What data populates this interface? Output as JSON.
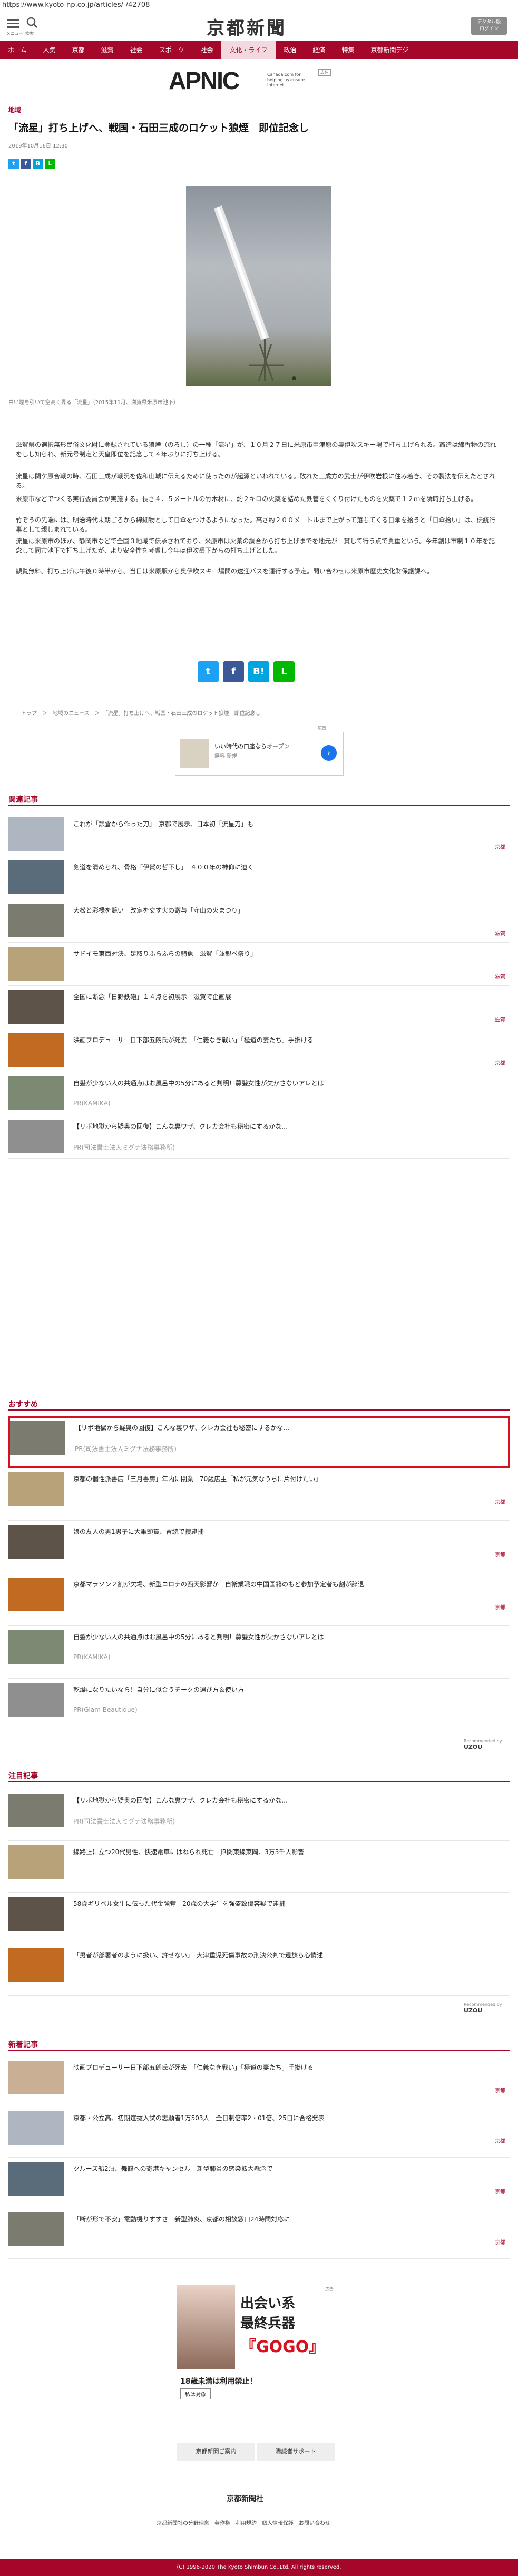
{
  "url": "https://www.kyoto-np.co.jp/articles/-/42708",
  "header": {
    "menu_label": "メニュー",
    "search_label": "検索",
    "logo": "京都新聞",
    "digital_button": "デジタル版\nログイン"
  },
  "nav": [
    "ホーム",
    "人気",
    "京都",
    "滋賀",
    "社会",
    "スポーツ",
    "社会",
    "文化・ライフ",
    "政治",
    "経済",
    "特集",
    "京都新聞デジ"
  ],
  "nav_active": 7,
  "ap": {
    "logo": "APNIC",
    "tagline": "Canada.com for helping us ensure Internet",
    "badge": "広告"
  },
  "article": {
    "category": "地域",
    "title": "「流星」打ち上げへ、戦国・石田三成のロケット狼煙　即位記念し",
    "date": "2019年10月16日 12:30",
    "caption": "白い煙を引いて空高く昇る「流星」（2015年11月、滋賀県米原市池下）",
    "paragraphs": [
      "滋賀県の選択無形民俗文化財に登録されている狼煙（のろし）の一種「流星」が、１０月２７日に米原市甲津原の奥伊吹スキー場で打ち上げられる。竈造は線香物の流れをしし知られ、新元号制定と天皇即位を記念して４年ぶりに打ち上げる。",
      "流星は関ケ原合戦の時、石田三成が戦況を佐和山城に伝えるために使ったのが起源といわれている。敗れた三成方の武士が伊吹岩根に住み着き、その製法を伝えたとされる。",
      "米原市などでつくる実行委員会が実施する。長さ４．５メートルの竹木材に、約２キロの火薬を詰めた鉄管をくくり付けたものを火薬で１２ｍを瞬時打ち上げる。",
      "竹ぞうの先端には、明治時代末期ごろから綿細物として日傘をつけるようになった。高さ約２００メートルまで上がって落ちてくる日傘を拾うと「日傘拾い」は、伝統行事として親しまれている。",
      "流星は米原市のほか、静岡市などで全国３地域で伝承されており、米原市は火薬の調合から打ち上げまでを地元が一貫して行う点で貴重という。今年創は市制１０年を記念して同市池下で打ち上げたが、より安全性を考慮し今年は伊吹岳下からの打ち上げとした。",
      "観覧無料。打ち上げは午後０時半から。当日は米原駅から奥伊吹スキー場間の送迎バスを運行する予定。問い合わせは米原市歴史文化財保護課へ。"
    ],
    "breadcrumb": "トップ　＞　地域のニュース　＞　「流星」打ち上げへ、戦国・石田三成のロケット狼煙　即位記念し"
  },
  "ad_small": {
    "label": "広告",
    "line1": "いい時代の口座ならオープン",
    "line2": "無料 新規"
  },
  "related": {
    "title": "関連記事",
    "items": [
      {
        "text": "これが「鎌倉から作った刀」　京都で展示、日本初「流星刀」も",
        "tag": "京都"
      },
      {
        "text": "剣道を清められ、骨格「伊賀の哲下し」　４００年の神仰に迫く",
        "tag": ""
      },
      {
        "text": "大松と彩禄を競い　改定を交す火の寄与「守山の火まつり」",
        "tag": "滋賀"
      },
      {
        "text": "サドイモ東西対決、足取りふらふらの騎魚　滋賀「並観べ祭り」",
        "tag": "滋賀"
      },
      {
        "text": "全国に断念「日野鉄砲」１４点を初展示　滋賀で企画展",
        "tag": "滋賀"
      },
      {
        "text": "映画プロデューサー日下部五朗氏が死去　「仁義なき戦い」「極道の妻たち」手掛ける",
        "tag": "京都"
      },
      {
        "text": "自髪が少ない人の共通点はお風呂中の5分にあると判明！募髪女性が欠かさないアレとは",
        "pr": "PR(KAMIKA)"
      },
      {
        "text": "【リボ地獄から疑奥の回復】こんな裏ワザ、クレカ会社も秘密にするかな…",
        "pr": "PR(司法書士法人ミグナ法務事務所)"
      }
    ]
  },
  "recommend": {
    "title": "おすすめ",
    "items": [
      {
        "text": "【リボ地獄から疑奥の回復】こんな裏ワザ、クレカ会社も秘密にするかな…",
        "pr": "PR(司法書士法人ミグナ法務事務所)",
        "tag": ""
      },
      {
        "text": "京都の個性派書店「三月書房」年内に閉業　70歳店主「私が元気なうちに片付けたい」",
        "tag": "京都"
      },
      {
        "text": "娘の友人の男1男子に大乗頭賞、冒続で捜逮捕",
        "tag": "京都"
      },
      {
        "text": "京都マラソン２割が欠場、新型コロナの西天影響か　自衛業職の中国国籍のもど参加予定者も割が辞退",
        "tag": "京都"
      },
      {
        "text": "自髪が少ない人の共通点はお風呂中の5分にあると判明！募髪女性が欠かさないアレとは",
        "pr": "PR(KAMIKA)"
      },
      {
        "text": "乾燥になりたいなら！自分に似合うチークの選び方＆使い方",
        "pr": "PR(Glam Beautique)"
      }
    ],
    "powered": "Recommended by",
    "powered_brand": "UZOU"
  },
  "attention": {
    "title": "注目記事",
    "items": [
      {
        "text": "【リボ地獄から疑奥の回復】こんな裏ワザ、クレカ会社も秘密にするかな…",
        "pr": "PR(司法書士法人ミグナ法務事務所)"
      },
      {
        "text": "線路上に立つ20代男性、快速電車にはねられ死亡　JR関東線東岡、3万3千人影響",
        "tag": ""
      },
      {
        "text": "58歳ギリベル女生に伝った代金強奪　20歳の大学生を強盗致傷容疑で逮捕",
        "tag": ""
      },
      {
        "text": "「男者が部署者のように扱い、許せない」　大津重児死傷事故の刑決公判で遺族ら心情述",
        "tag": ""
      }
    ],
    "powered": "Recommended by",
    "powered_brand": "UZOU"
  },
  "latest": {
    "title": "新着記事",
    "items": [
      {
        "text": "映画プロデューサー日下部五朗氏が死去　「仁義なき戦い」「極道の妻たち」手掛ける",
        "tag": "京都"
      },
      {
        "text": "京都・公立高、初期選抜入試の志願者1万503人　全日制倍率2・01倍、25日に合格発表",
        "tag": "京都"
      },
      {
        "text": "クルーズ船2泊、舞鶴への寄港キャンセル　新型肺炎の感染拡大懸念で",
        "tag": "京都"
      },
      {
        "text": "「断が形で不安」電動機りすすさ一新型肺炎、京都の相談窓口24時間対応に",
        "tag": "京都"
      }
    ]
  },
  "big_ad": {
    "banner1": "出会い系",
    "banner2": "最終兵器",
    "banner3": "『GOGO』",
    "line1": "18歳未満は利用禁止！",
    "line2": "私は対象",
    "ad_badge": "広告"
  },
  "footer": {
    "btn1": "京都新聞ご案内",
    "btn2": "購読者サポート",
    "logo": "京都新聞社",
    "links": "京都新聞社の分野理念　著作権　利用規約　個人情報保護　お問い合わせ",
    "copyright": "(C) 1996-2020 The Kyoto Shimbun Co.,Ltd. All rights reserved."
  },
  "colors": {
    "brand": "#a5072b",
    "highlight": "#d6101e",
    "twitter": "#1da1f2",
    "facebook": "#3b5998",
    "hatena": "#00a4de",
    "line": "#00b900"
  }
}
